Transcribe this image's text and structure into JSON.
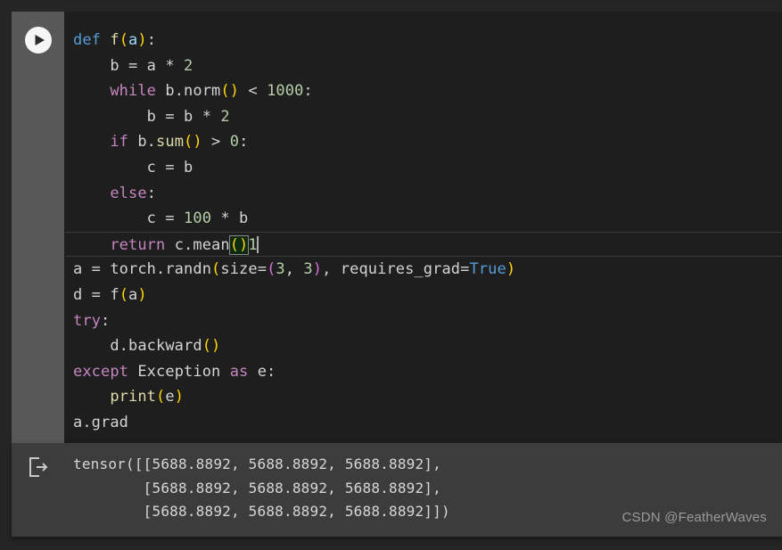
{
  "theme": {
    "page_background": "#252526",
    "code_background": "#1e1e1e",
    "gutter_background": "#585858",
    "output_background": "#3c3c3c",
    "keyword_color": "#c586c0",
    "def_color": "#569cd6",
    "function_color": "#dcdcaa",
    "number_color": "#b5cea8",
    "paren_gold": "#ffd700",
    "paren_pink": "#da70d6",
    "text_color": "#d4d4d4"
  },
  "cell": {
    "run_button_label": "run-cell",
    "run_icon": "play-icon",
    "output_icon": "output-arrow-icon"
  },
  "code": {
    "lines": [
      {
        "id": "line-1",
        "text": "def f(a):",
        "tokens": [
          {
            "t": "def",
            "c": "t-def"
          },
          {
            "t": " ",
            "c": "t-plain"
          },
          {
            "t": "f",
            "c": "t-fn"
          },
          {
            "t": "(",
            "c": "t-p-gold"
          },
          {
            "t": "a",
            "c": "t-param"
          },
          {
            "t": ")",
            "c": "t-p-gold"
          },
          {
            "t": ":",
            "c": "t-plain"
          }
        ]
      },
      {
        "id": "line-2",
        "text": "    b = a * 2",
        "tokens": [
          {
            "t": "    b = a * ",
            "c": "t-plain"
          },
          {
            "t": "2",
            "c": "t-num"
          }
        ]
      },
      {
        "id": "line-3",
        "text": "    while b.norm() < 1000:",
        "tokens": [
          {
            "t": "    ",
            "c": "t-plain"
          },
          {
            "t": "while",
            "c": "t-kw"
          },
          {
            "t": " b.norm",
            "c": "t-plain"
          },
          {
            "t": "()",
            "c": "t-p-gold"
          },
          {
            "t": " < ",
            "c": "t-plain"
          },
          {
            "t": "1000",
            "c": "t-num"
          },
          {
            "t": ":",
            "c": "t-plain"
          }
        ]
      },
      {
        "id": "line-4",
        "text": "        b = b * 2",
        "tokens": [
          {
            "t": "        b = b * ",
            "c": "t-plain"
          },
          {
            "t": "2",
            "c": "t-num"
          }
        ]
      },
      {
        "id": "line-5",
        "text": "    if b.sum() > 0:",
        "tokens": [
          {
            "t": "    ",
            "c": "t-plain"
          },
          {
            "t": "if",
            "c": "t-kw"
          },
          {
            "t": " b.",
            "c": "t-plain"
          },
          {
            "t": "sum",
            "c": "t-fn"
          },
          {
            "t": "()",
            "c": "t-p-gold"
          },
          {
            "t": " > ",
            "c": "t-plain"
          },
          {
            "t": "0",
            "c": "t-num"
          },
          {
            "t": ":",
            "c": "t-plain"
          }
        ]
      },
      {
        "id": "line-6",
        "text": "        c = b",
        "tokens": [
          {
            "t": "        c = b",
            "c": "t-plain"
          }
        ]
      },
      {
        "id": "line-7",
        "text": "    else:",
        "tokens": [
          {
            "t": "    ",
            "c": "t-plain"
          },
          {
            "t": "else",
            "c": "t-kw"
          },
          {
            "t": ":",
            "c": "t-plain"
          }
        ]
      },
      {
        "id": "line-8",
        "text": "        c = 100 * b",
        "tokens": [
          {
            "t": "        c = ",
            "c": "t-plain"
          },
          {
            "t": "100",
            "c": "t-num"
          },
          {
            "t": " * b",
            "c": "t-plain"
          }
        ]
      },
      {
        "id": "line-9",
        "text": "    return c.mean()1",
        "active": true,
        "tokens": [
          {
            "t": "    ",
            "c": "t-plain"
          },
          {
            "t": "return",
            "c": "t-kw"
          },
          {
            "t": " c.mean",
            "c": "t-plain"
          },
          {
            "t": "()",
            "c": "t-p-gold",
            "bracket_match": true
          },
          {
            "t": "1",
            "c": "t-num"
          }
        ]
      },
      {
        "id": "line-10",
        "text": "a = torch.randn(size=(3, 3), requires_grad=True)",
        "tokens": [
          {
            "t": "a = torch.randn",
            "c": "t-plain"
          },
          {
            "t": "(",
            "c": "t-p-gold"
          },
          {
            "t": "size=",
            "c": "t-plain"
          },
          {
            "t": "(",
            "c": "t-p-pink"
          },
          {
            "t": "3",
            "c": "t-num"
          },
          {
            "t": ", ",
            "c": "t-plain"
          },
          {
            "t": "3",
            "c": "t-num"
          },
          {
            "t": ")",
            "c": "t-p-pink"
          },
          {
            "t": ", requires_grad=",
            "c": "t-plain"
          },
          {
            "t": "True",
            "c": "t-const"
          },
          {
            "t": ")",
            "c": "t-p-gold"
          }
        ]
      },
      {
        "id": "line-11",
        "text": "d = f(a)",
        "tokens": [
          {
            "t": "d = f",
            "c": "t-plain"
          },
          {
            "t": "(",
            "c": "t-p-gold"
          },
          {
            "t": "a",
            "c": "t-plain"
          },
          {
            "t": ")",
            "c": "t-p-gold"
          }
        ]
      },
      {
        "id": "line-12",
        "text": "try:",
        "tokens": [
          {
            "t": "try",
            "c": "t-kw"
          },
          {
            "t": ":",
            "c": "t-plain"
          }
        ]
      },
      {
        "id": "line-13",
        "text": "    d.backward()",
        "tokens": [
          {
            "t": "    d.backward",
            "c": "t-plain"
          },
          {
            "t": "()",
            "c": "t-p-gold"
          }
        ]
      },
      {
        "id": "line-14",
        "text": "except Exception as e:",
        "tokens": [
          {
            "t": "except",
            "c": "t-kw"
          },
          {
            "t": " Exception ",
            "c": "t-plain"
          },
          {
            "t": "as",
            "c": "t-kw"
          },
          {
            "t": " e:",
            "c": "t-plain"
          }
        ]
      },
      {
        "id": "line-15",
        "text": "    print(e)",
        "tokens": [
          {
            "t": "    ",
            "c": "t-plain"
          },
          {
            "t": "print",
            "c": "t-fn"
          },
          {
            "t": "(",
            "c": "t-p-gold"
          },
          {
            "t": "e",
            "c": "t-plain"
          },
          {
            "t": ")",
            "c": "t-p-gold"
          }
        ]
      },
      {
        "id": "line-16",
        "text": "a.grad",
        "tokens": [
          {
            "t": "a.grad",
            "c": "t-plain"
          }
        ]
      }
    ]
  },
  "output": {
    "text": "tensor([[5688.8892, 5688.8892, 5688.8892],\n        [5688.8892, 5688.8892, 5688.8892],\n        [5688.8892, 5688.8892, 5688.8892]])",
    "lines": [
      "tensor([[5688.8892, 5688.8892, 5688.8892],",
      "        [5688.8892, 5688.8892, 5688.8892],",
      "        [5688.8892, 5688.8892, 5688.8892]])"
    ]
  },
  "watermark": {
    "text": "CSDN @FeatherWaves"
  }
}
